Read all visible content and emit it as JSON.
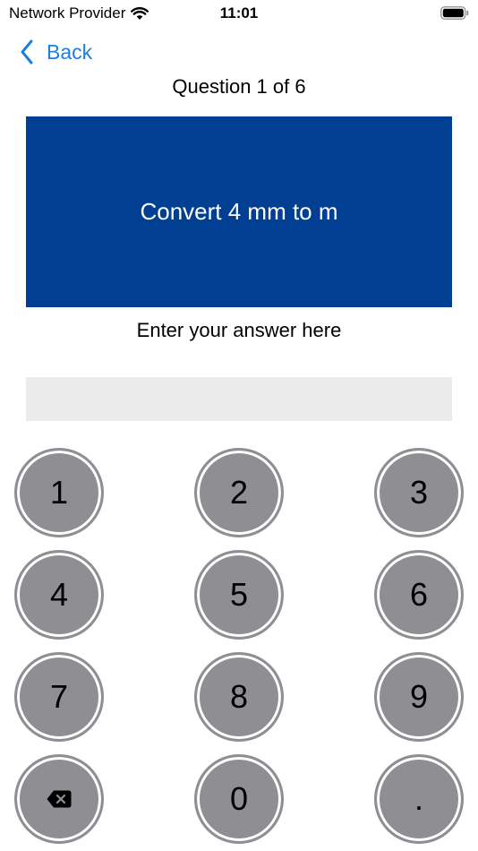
{
  "status_bar": {
    "carrier": "Network Provider",
    "time": "11:01",
    "wifi_icon": "wifi-icon",
    "battery_icon": "battery-icon"
  },
  "nav": {
    "back_label": "Back",
    "back_icon": "chevron-left-icon"
  },
  "question": {
    "counter": "Question 1 of 6",
    "text": "Convert 4 mm to m",
    "card_color": "#003f91"
  },
  "answer": {
    "prompt": "Enter your answer here",
    "value": ""
  },
  "keypad": {
    "keys": [
      "1",
      "2",
      "3",
      "4",
      "5",
      "6",
      "7",
      "8",
      "9",
      "",
      "0",
      "."
    ],
    "delete_icon": "backspace-icon",
    "key_color": "#8e8e93"
  },
  "accent_color": "#1a7fe0"
}
